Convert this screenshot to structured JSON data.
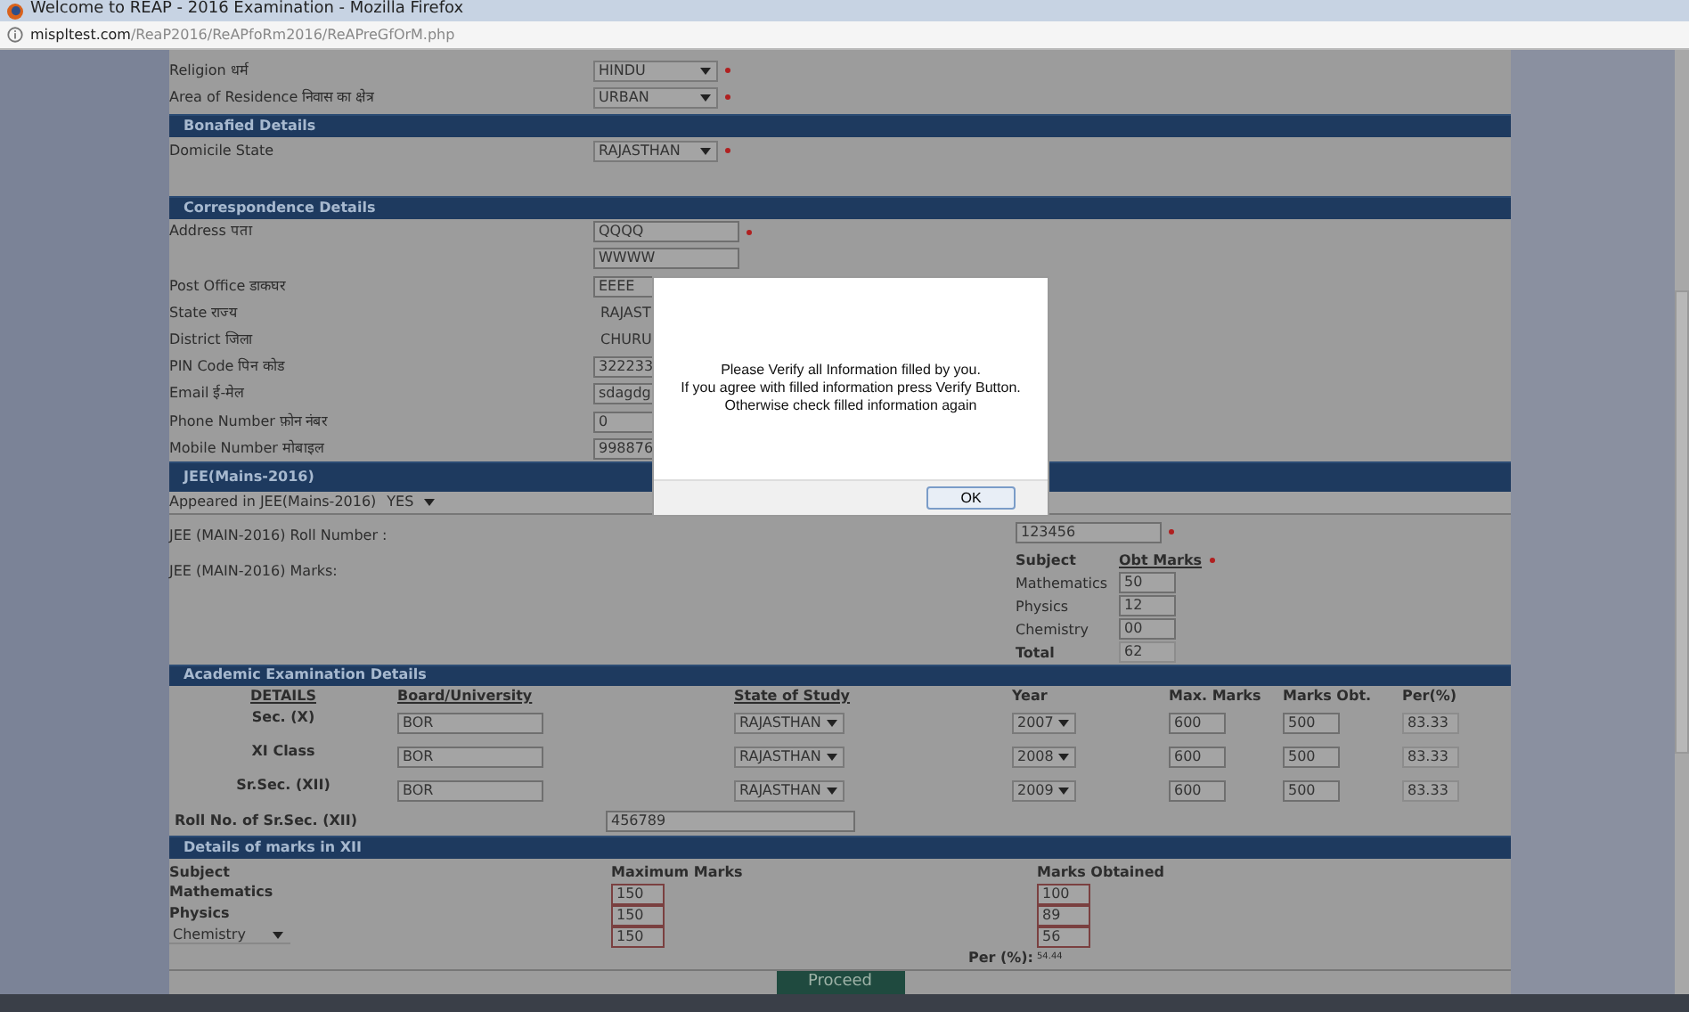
{
  "window": {
    "title": "Welcome to REAP - 2016 Examination - Mozilla Firefox"
  },
  "address_bar": {
    "domain": "mispltest.com",
    "path": "/ReaP2016/ReAPfoRm2016/ReAPreGfOrM.php"
  },
  "personal_fields": [
    {
      "label": "Religion धर्म",
      "value": "HINDU",
      "kind": "select",
      "required": true
    },
    {
      "label": "Area of Residence निवास का क्षेत्र",
      "value": "URBAN",
      "kind": "select",
      "required": true
    }
  ],
  "bonafied": {
    "title": "Bonafied Details",
    "fields": [
      {
        "label": "Domicile State",
        "value": "RAJASTHAN",
        "kind": "select",
        "required": true
      }
    ]
  },
  "correspondence": {
    "title": "Correspondence Details",
    "fields": [
      {
        "label": "Address पता",
        "value": "QQQQ",
        "kind": "text",
        "required": true
      },
      {
        "value": "WWWW",
        "kind": "text",
        "required": false
      },
      {
        "label": "Post Office डाकघर",
        "value": "EEEE",
        "kind": "text",
        "required": false
      },
      {
        "label": "State राज्य",
        "value": "RAJAST",
        "kind": "plain",
        "required": false
      },
      {
        "label": "District जिला",
        "value": "CHURU",
        "kind": "plain",
        "required": false
      },
      {
        "label": "PIN Code पिन कोड",
        "value": "322233",
        "kind": "text",
        "required": false
      },
      {
        "label": "Email ई-मेल",
        "value": "sdagdg",
        "kind": "text",
        "required": false
      },
      {
        "label": "Phone Number फ़ोन नंबर",
        "value": "0",
        "kind": "text",
        "required": false
      },
      {
        "label": "Mobile Number मोबाइल",
        "value": "998876",
        "kind": "text",
        "required": false
      }
    ]
  },
  "jee": {
    "title": "JEE(Mains-2016)",
    "appeared_label": "Appeared in JEE(Mains-2016)",
    "appeared_value": "YES",
    "roll_label": "JEE (MAIN-2016) Roll Number :",
    "roll_value": "123456",
    "roll_required": true,
    "marks_label": "JEE (MAIN-2016) Marks:",
    "marks_table": {
      "subject_heading": "Subject",
      "marks_heading": "Obt Marks",
      "marks_required": true,
      "rows": [
        {
          "subject": "Mathematics",
          "marks": "50"
        },
        {
          "subject": "Physics",
          "marks": "12"
        },
        {
          "subject": "Chemistry",
          "marks": "00"
        }
      ],
      "total_label": "Total",
      "total_value": "62"
    }
  },
  "academic": {
    "title": "Academic Examination Details",
    "columns": [
      "DETAILS",
      "Board/University",
      "State of Study",
      "Year",
      "Max. Marks",
      "Marks Obt.",
      "Per(%)"
    ],
    "rows": [
      {
        "class": "Sec. (X)",
        "board": "BOR",
        "state": "RAJASTHAN",
        "year": "2007",
        "max": "600",
        "obt": "500",
        "per": "83.33"
      },
      {
        "class": "XI Class",
        "board": "BOR",
        "state": "RAJASTHAN",
        "year": "2008",
        "max": "600",
        "obt": "500",
        "per": "83.33"
      },
      {
        "class": "Sr.Sec. (XII)",
        "board": "BOR",
        "state": "RAJASTHAN",
        "year": "2009",
        "max": "600",
        "obt": "500",
        "per": "83.33"
      }
    ],
    "roll_label": "Roll No. of Sr.Sec. (XII)",
    "roll_value": "456789"
  },
  "xii_marks": {
    "title": "Details of marks in XII",
    "subject_heading": "Subject",
    "max_heading": "Maximum Marks",
    "obt_heading": "Marks Obtained",
    "rows": [
      {
        "subject": "Mathematics",
        "kind": "label",
        "max": "150",
        "obt": "100"
      },
      {
        "subject": "Physics",
        "kind": "label",
        "max": "150",
        "obt": "89"
      },
      {
        "subject": "Chemistry",
        "kind": "select",
        "max": "150",
        "obt": "56"
      }
    ],
    "per_label": "Per (%):",
    "per_value": "54.44"
  },
  "proceed_button": "Proceed",
  "dialog": {
    "lines": [
      "Please Verify all Information filled by you.",
      "If you agree with filled information press Verify Button.",
      "Otherwise check filled information again"
    ],
    "ok_button": "OK"
  }
}
